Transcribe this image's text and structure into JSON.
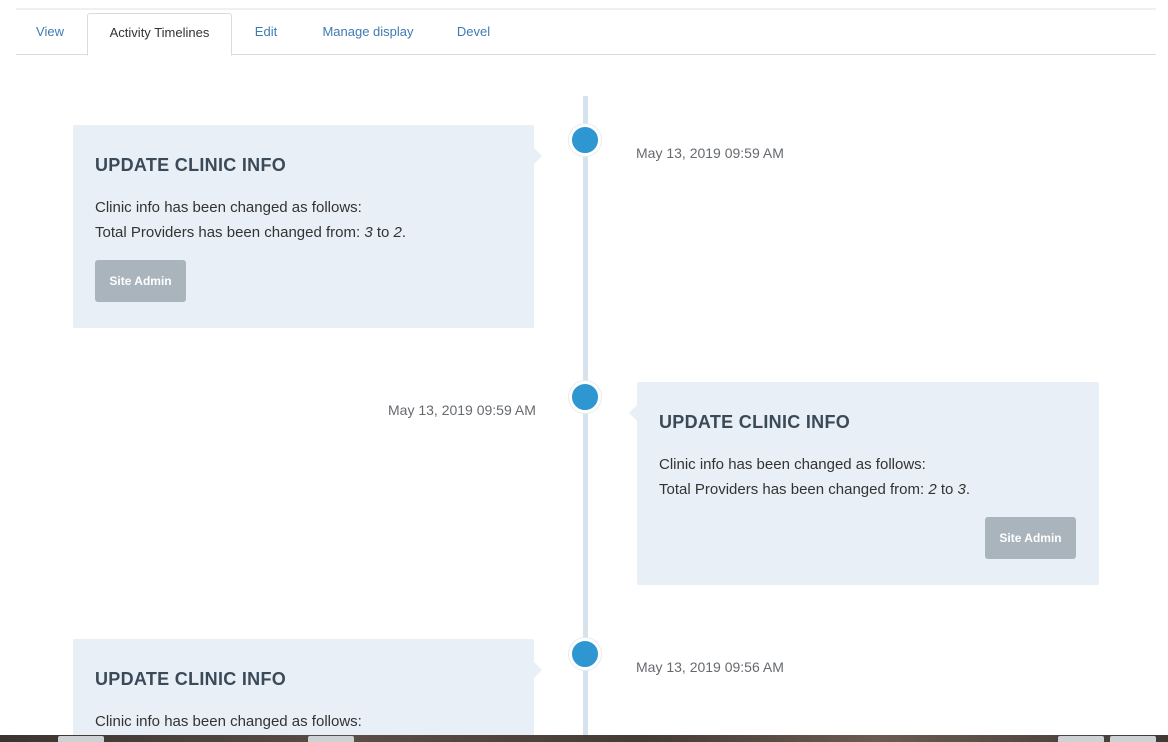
{
  "tabs": [
    {
      "label": "View",
      "active": false
    },
    {
      "label": "Activity Timelines",
      "active": true
    },
    {
      "label": "Edit",
      "active": false
    },
    {
      "label": "Manage display",
      "active": false
    },
    {
      "label": "Devel",
      "active": false
    }
  ],
  "timeline": [
    {
      "side": "left",
      "title": "UPDATE CLINIC INFO",
      "line1": "Clinic info has been changed as follows:",
      "line2_prefix": "Total Providers has been changed from: ",
      "from": "3",
      "to_word": " to ",
      "to": "2",
      "suffix": ".",
      "button": "Site Admin",
      "timestamp": "May 13, 2019 09:59 AM"
    },
    {
      "side": "right",
      "title": "UPDATE CLINIC INFO",
      "line1": "Clinic info has been changed as follows:",
      "line2_prefix": "Total Providers has been changed from: ",
      "from": "2",
      "to_word": " to ",
      "to": "3",
      "suffix": ".",
      "button": "Site Admin",
      "timestamp": "May 13, 2019 09:59 AM"
    },
    {
      "side": "left",
      "title": "UPDATE CLINIC INFO",
      "line1": "Clinic info has been changed as follows:",
      "timestamp": "May 13, 2019 09:56 AM"
    }
  ],
  "colors": {
    "accent": "#2e97d1",
    "card_bg": "#e8eff6",
    "button_bg": "#a9b4bd",
    "tab_link": "#3f7ab3"
  }
}
